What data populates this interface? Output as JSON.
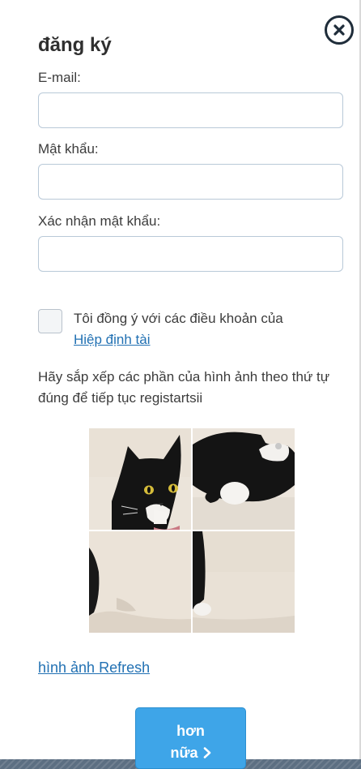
{
  "form": {
    "title": "đăng ký",
    "close_icon": "close-icon",
    "email_label": "E-mail:",
    "email_value": "",
    "password_label": "Mật khẩu:",
    "password_value": "",
    "confirm_label": "Xác nhận mật khẩu:",
    "confirm_value": "",
    "terms_checked": false,
    "terms_text": "Tôi đồng ý với các điều khoản của",
    "terms_link": "Hiệp định tài",
    "captcha_instructions": "Hãy sắp xếp các phần của hình ảnh theo thứ tự đúng để tiếp tục registartsii",
    "captcha_tiles": [
      "cat-face-tile",
      "cat-body-tile",
      "cat-shadow-tile",
      "cat-paw-tile"
    ],
    "refresh_link": "hình ảnh Refresh",
    "next_button_line1": "hơn",
    "next_button_line2": "nữa",
    "next_icon": "chevron-right-icon"
  }
}
